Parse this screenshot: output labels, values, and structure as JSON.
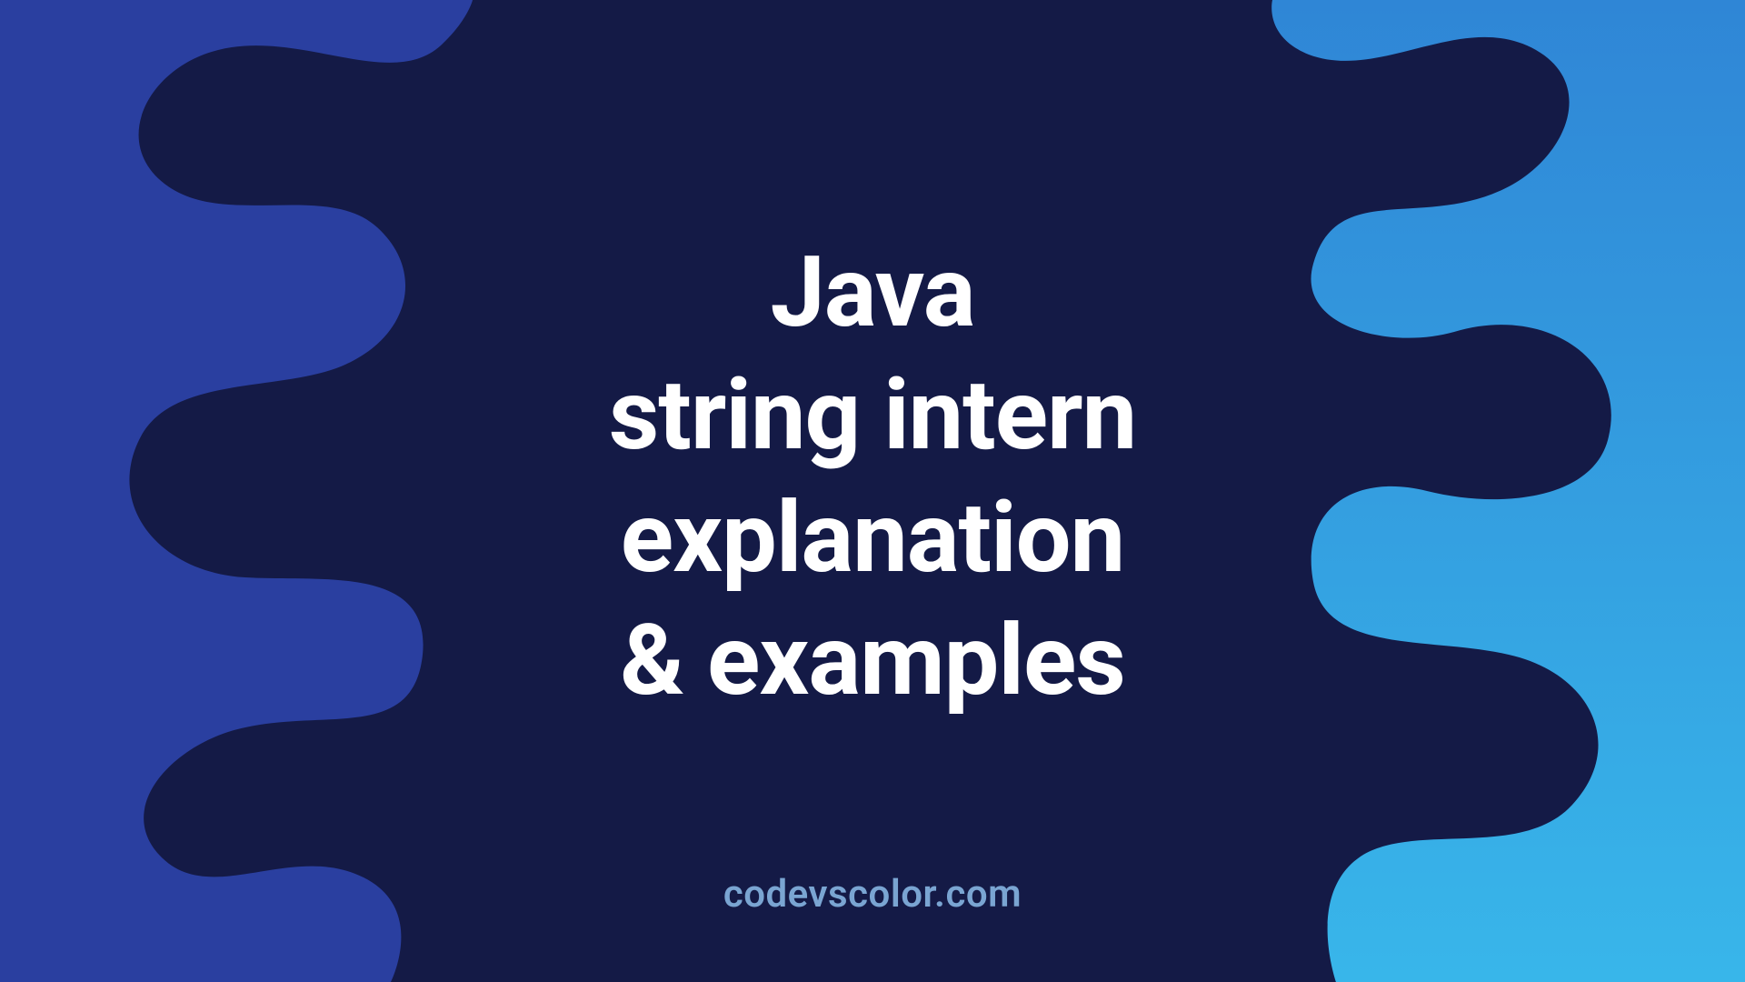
{
  "title": {
    "line1": "Java",
    "line2": "string intern",
    "line3": "explanation",
    "line4": "& examples"
  },
  "site": "codevscolor.com",
  "colors": {
    "bg_dark": "#141a46",
    "left_panel": "#2a3fa0",
    "right_panel_top": "#2f86d6",
    "right_panel_bottom": "#38b6ea",
    "title_text": "#ffffff",
    "credit_text": "#7aa5d2"
  }
}
